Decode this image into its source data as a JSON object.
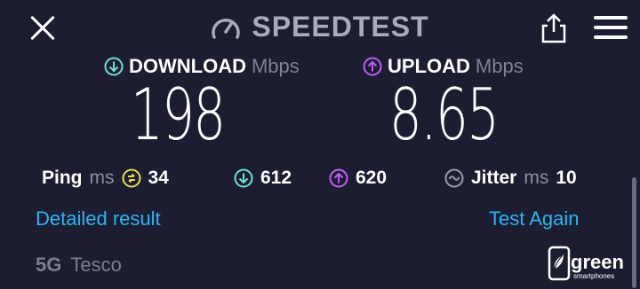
{
  "header": {
    "title": "SPEEDTEST"
  },
  "download": {
    "label": "DOWNLOAD",
    "unit": "Mbps",
    "value": "198"
  },
  "upload": {
    "label": "UPLOAD",
    "unit": "Mbps",
    "value": "8.65"
  },
  "stats": {
    "ping_label": "Ping",
    "ping_unit": "ms",
    "ping_value": "34",
    "down_latency": "612",
    "up_latency": "620",
    "jitter_label": "Jitter",
    "jitter_unit": "ms",
    "jitter_value": "10"
  },
  "links": {
    "detailed": "Detailed result",
    "again": "Test Again"
  },
  "network": {
    "generation": "5G",
    "carrier": "Tesco"
  },
  "watermark": {
    "name": "green",
    "tagline": "smartphones"
  },
  "colors": {
    "background": "#1d1d32",
    "download_accent": "#6fe0d6",
    "upload_accent": "#c05ff2",
    "ping_accent": "#e8dd4a",
    "link": "#27b6f2"
  },
  "icons": {
    "close": "close-icon",
    "gauge": "speedometer-icon",
    "share": "share-icon",
    "menu": "hamburger-menu-icon",
    "download": "arrow-down-circle-icon",
    "upload": "arrow-up-circle-icon",
    "ping": "ping-icon",
    "jitter": "jitter-icon"
  }
}
